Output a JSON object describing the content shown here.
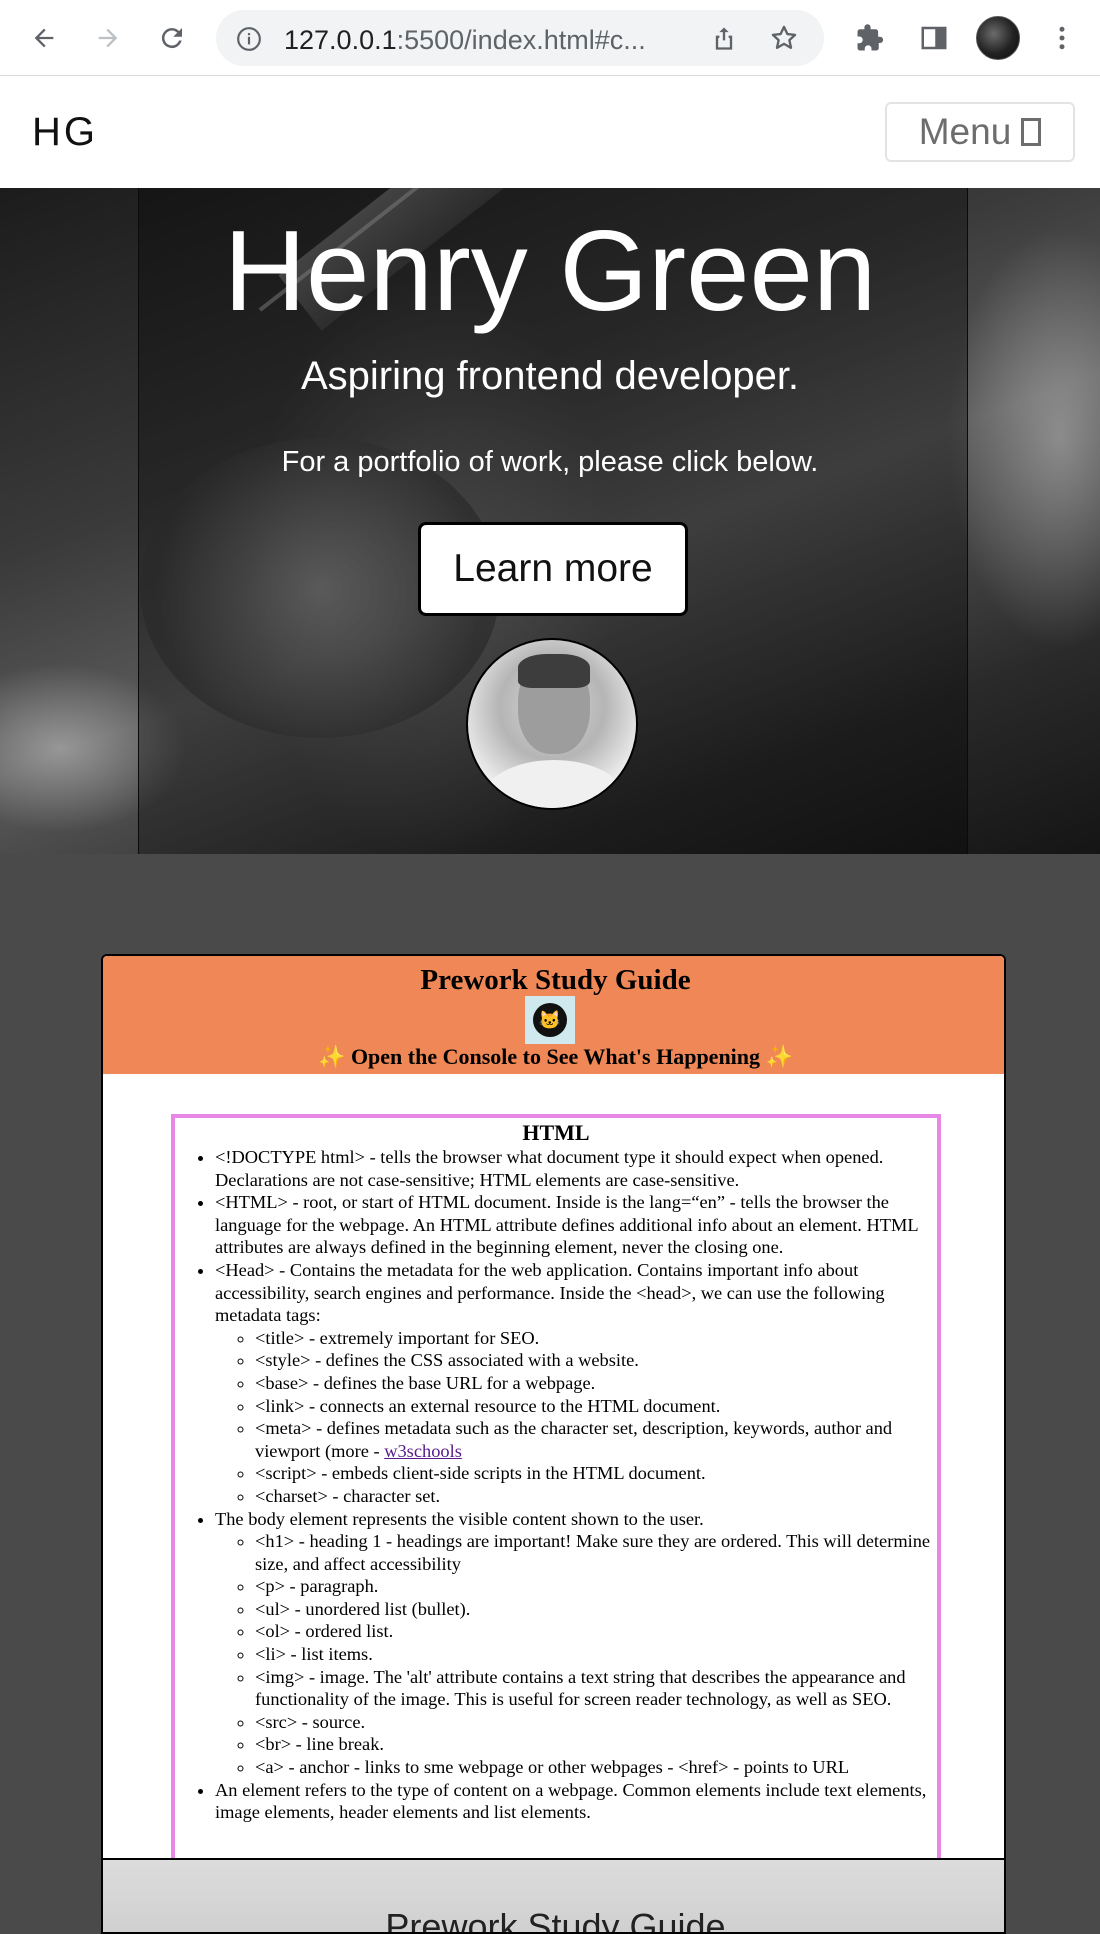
{
  "browser": {
    "url_host": "127.0.0.1",
    "url_rest": ":5500/index.html#c..."
  },
  "header": {
    "logo": "HG",
    "menu_label": "Menu"
  },
  "hero": {
    "title": "Henry Green",
    "subtitle": "Aspiring frontend developer.",
    "text": "For a portfolio of work, please click below.",
    "button_label": "Learn more"
  },
  "project": {
    "title": "Prework Study Guide",
    "console_text": "Open the Console to See What's Happening",
    "sparkle": "✨",
    "section_title": "HTML",
    "items": [
      "<!DOCTYPE html> - tells the browser what document type it should expect when opened. Declarations are not case-sensitive; HTML elements are case-sensitive.",
      "<HTML> - root, or start of HTML document. Inside is the lang=“en” - tells the browser the language for the webpage. An HTML attribute defines additional info about an element. HTML attributes are always defined in the beginning element, never the closing one.",
      "<Head> - Contains the metadata for the web application. Contains important info about accessibility, search engines and performance. Inside the <head>, we can use the following metadata tags:"
    ],
    "head_tags": [
      "<title> - extremely important for SEO.",
      "<style> - defines the CSS associated with a website.",
      "<base> - defines the base URL for a webpage.",
      "<link> - connects an external resource to the HTML document.",
      "<meta> - defines metadata such as the character set, description, keywords, author and viewport (more - ",
      "<script> - embeds client-side scripts in the HTML document.",
      "<charset> - character set."
    ],
    "meta_link": "w3schools",
    "body_item": "The body element represents the visible content shown to the user.",
    "body_tags": [
      "<h1> - heading 1 - headings are important! Make sure they are ordered. This will determine size, and affect accessibility",
      "<p> - paragraph.",
      "<ul> - unordered list (bullet).",
      "<ol> - ordered list.",
      "<li> - list items.",
      "<img> - image. The 'alt' attribute contains a text string that describes the appearance and functionality of the image. This is useful for screen reader technology, as well as SEO.",
      "<src> - source.",
      "<br> - line break.",
      "<a> - anchor - links to sme webpage or other webpages - <href> - points to URL"
    ],
    "element_item": "An element refers to the type of content on a webpage. Common elements include text elements, image elements, header elements and list elements.",
    "footer_title": "Prework Study Guide"
  },
  "colors": {
    "guide_header": "#ef8856",
    "html_box_border": "#e987e6",
    "page_bg": "#4a4a4a"
  }
}
